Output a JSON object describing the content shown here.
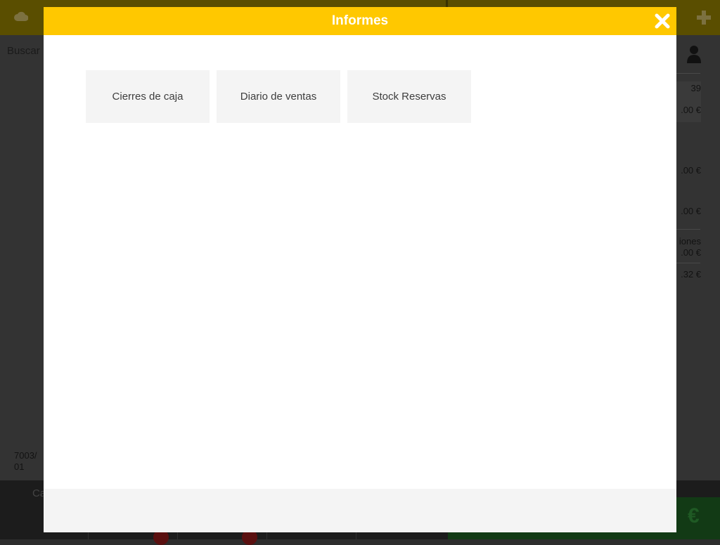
{
  "background_app": {
    "search_label": "Buscar",
    "right_panel": {
      "line1": "39",
      "line2": ".00 €",
      "line3": ".00 €",
      "line4": ".00 €",
      "line5a": "iones",
      "line5b": ".00 €",
      "line6": ".32 €"
    },
    "ticket_ref": [
      "7003/",
      "01"
    ],
    "bottom_label": "Ca",
    "total_symbol": "€"
  },
  "modal": {
    "title": "Informes",
    "buttons": [
      {
        "label": "Cierres de caja"
      },
      {
        "label": "Diario de ventas"
      },
      {
        "label": "Stock Reservas"
      }
    ]
  },
  "colors": {
    "header_yellow": "#ffc800",
    "button_gray": "#f4f4f4"
  },
  "icons": [
    "cloud-icon",
    "plus-icon",
    "user-icon",
    "close-icon"
  ]
}
